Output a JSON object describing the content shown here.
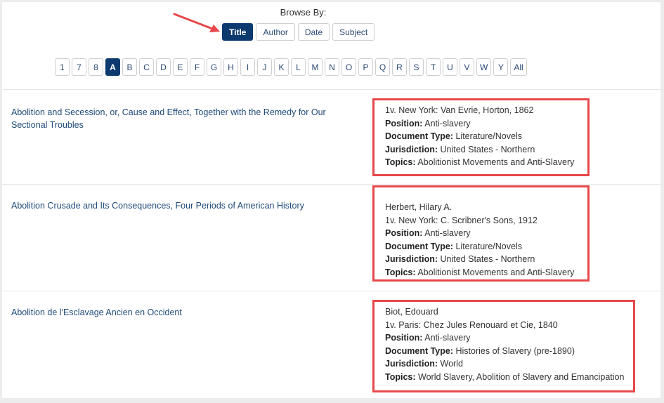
{
  "browse": {
    "label": "Browse By:",
    "buttons": [
      {
        "label": "Title",
        "active": true
      },
      {
        "label": "Author",
        "active": false
      },
      {
        "label": "Date",
        "active": false
      },
      {
        "label": "Subject",
        "active": false
      }
    ]
  },
  "letters": [
    "1",
    "7",
    "8",
    "A",
    "B",
    "C",
    "D",
    "E",
    "F",
    "G",
    "H",
    "I",
    "J",
    "K",
    "L",
    "M",
    "N",
    "O",
    "P",
    "Q",
    "R",
    "S",
    "T",
    "U",
    "V",
    "W",
    "Y",
    "All"
  ],
  "active_letter": "A",
  "colors": {
    "accent": "#0d3a6e",
    "highlight_box": "#e8474a",
    "link": "#1f4a7a"
  },
  "field_labels": {
    "position": "Position:",
    "document_type": "Document Type:",
    "jurisdiction": "Jurisdiction:",
    "topics": "Topics:"
  },
  "results": [
    {
      "title": "Abolition and Secession, or, Cause and Effect, Together with the Remedy for Our Sectional Troubles",
      "author": "",
      "publication": "1v. New York: Van Evrie, Horton, 1862",
      "position": "Anti-slavery",
      "document_type": "Literature/Novels",
      "jurisdiction": "United States - Northern",
      "topics": "Abolitionist Movements and Anti-Slavery"
    },
    {
      "title": "Abolition Crusade and Its Consequences, Four Periods of American History",
      "author": "Herbert, Hilary A.",
      "publication": "1v. New York: C. Scribner's Sons, 1912",
      "position": "Anti-slavery",
      "document_type": "Literature/Novels",
      "jurisdiction": "United States - Northern",
      "topics": "Abolitionist Movements and Anti-Slavery"
    },
    {
      "title": "Abolition de l'Esclavage Ancien en Occident",
      "author": "Biot, Edouard",
      "publication": "1v. Paris: Chez Jules Renouard et Cie, 1840",
      "position": "Anti-slavery",
      "document_type": "Histories of Slavery (pre-1890)",
      "jurisdiction": "World",
      "topics": "World Slavery, Abolition of Slavery and Emancipation"
    }
  ]
}
